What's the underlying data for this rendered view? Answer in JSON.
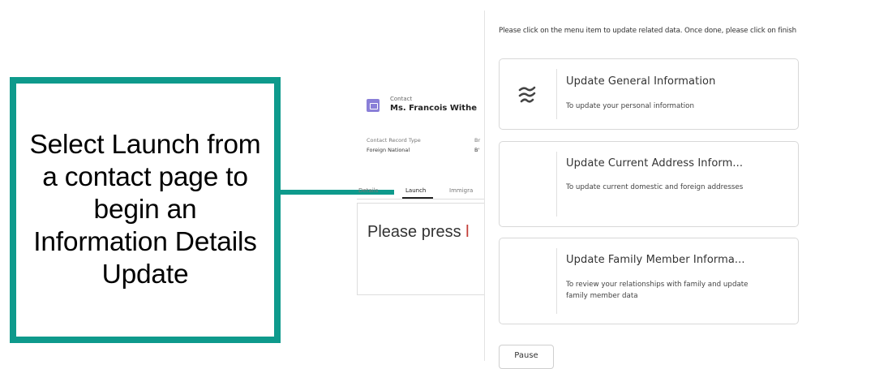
{
  "callout": {
    "text": "Select Launch from a contact page to begin an Information Details Update",
    "accent": "#0e9a8c"
  },
  "record": {
    "object_type": "Contact",
    "name": "Ms. Francois Withe",
    "fields": [
      {
        "label": "Contact Record Type",
        "value": "Foreign National"
      },
      {
        "label": "Br",
        "value": "B'"
      }
    ],
    "tabs": [
      "Details",
      "Launch",
      "Immigra"
    ],
    "active_tab": "Launch",
    "message_prefix": "Please press ",
    "message_highlight": "l"
  },
  "flow": {
    "instructions": "Please click on the menu item to update related data. Once done, please click on finish",
    "items": [
      {
        "title": "Update General Information",
        "description": "To update your personal information",
        "icon": "wave-lines-icon"
      },
      {
        "title": "Update Current Address Inform...",
        "description": "To update current domestic and foreign addresses"
      },
      {
        "title": "Update Family Member Informa...",
        "description": "To review your relationships with family and update family member data"
      }
    ],
    "pause_label": "Pause"
  }
}
